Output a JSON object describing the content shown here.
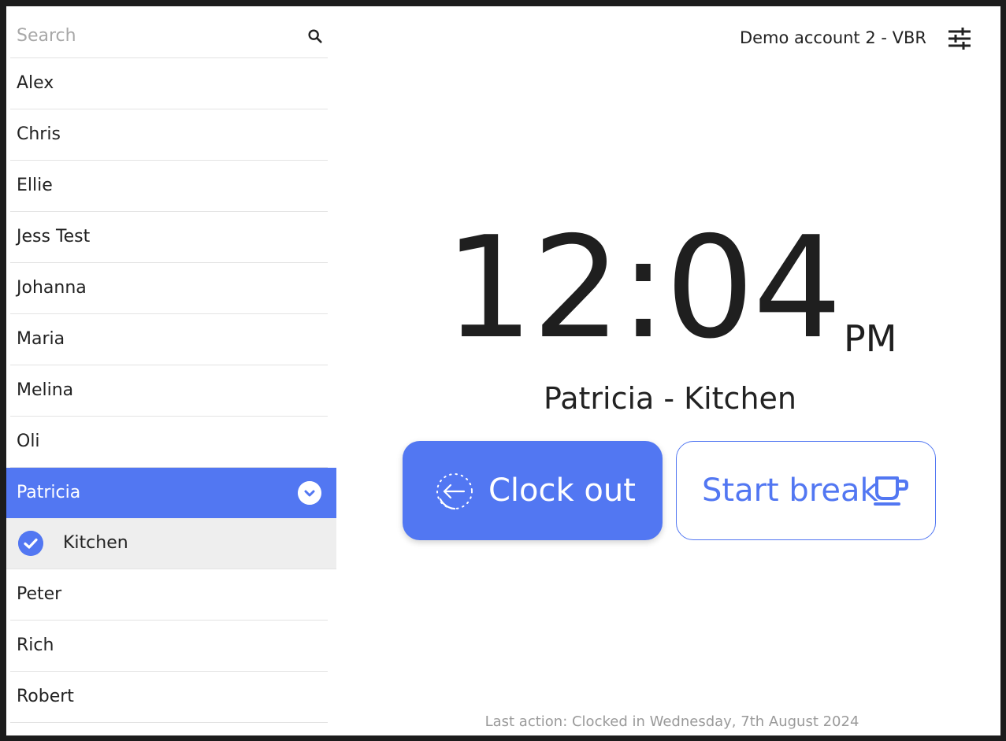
{
  "search": {
    "placeholder": "Search"
  },
  "employees": [
    {
      "name": "Alex"
    },
    {
      "name": "Chris"
    },
    {
      "name": "Ellie"
    },
    {
      "name": "Jess Test"
    },
    {
      "name": "Johanna"
    },
    {
      "name": "Maria"
    },
    {
      "name": "Melina"
    },
    {
      "name": "Oli"
    },
    {
      "name": "Patricia",
      "selected": true,
      "roles": [
        "Kitchen"
      ]
    },
    {
      "name": "Peter"
    },
    {
      "name": "Rich"
    },
    {
      "name": "Robert"
    }
  ],
  "header": {
    "account": "Demo account 2 - VBR"
  },
  "clock": {
    "time": "12:04",
    "ampm": "PM"
  },
  "current": {
    "employee_role": "Patricia - Kitchen"
  },
  "actions": {
    "clock_out": "Clock out",
    "start_break": "Start break"
  },
  "status": {
    "last_action": "Last action: Clocked in Wednesday, 7th August 2024"
  },
  "colors": {
    "accent": "#5277f2",
    "selected_sub_bg": "#eeeeee",
    "muted_text": "#9a9a9a"
  },
  "icons": {
    "search": "search-icon",
    "settings": "sliders-icon",
    "chevron": "chevron-down-icon",
    "check": "check-circle-icon",
    "clock_out": "clock-out-arrow-icon",
    "break": "coffee-cup-icon"
  }
}
